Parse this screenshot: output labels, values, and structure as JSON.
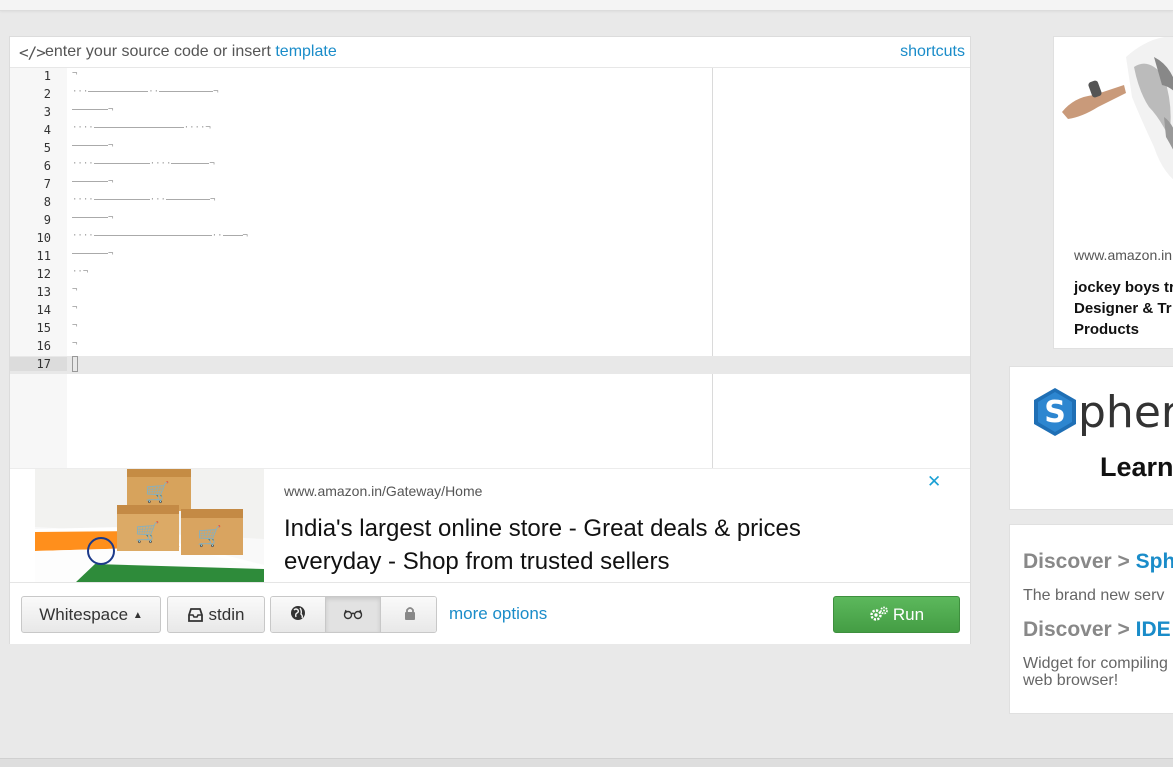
{
  "editor": {
    "header_prompt": "enter your source code or insert",
    "template_link": "template",
    "shortcuts_link": "shortcuts",
    "code_icon": "</>",
    "line_numbers": [
      "1",
      "2",
      "3",
      "4",
      "5",
      "6",
      "7",
      "8",
      "9",
      "10",
      "11",
      "12",
      "13",
      "14",
      "15",
      "16",
      "17"
    ],
    "active_line": "17"
  },
  "ad_banner": {
    "url": "www.amazon.in/Gateway/Home",
    "headline": "India's largest online store - Great deals & prices everyday - Shop from trusted sellers",
    "close_icon": "close-icon",
    "close_glyph": "✕"
  },
  "toolbar": {
    "language_label": "Whitespace",
    "stdin_label": "stdin",
    "more_options": "more options",
    "run_label": "Run",
    "icons": [
      "globe-icon",
      "glasses-icon",
      "lock-icon",
      "gears-icon",
      "inbox-icon",
      "caret-up-icon"
    ]
  },
  "side_ad": {
    "url": "www.amazon.in",
    "title": "jockey boys tr Designer & Tr Products"
  },
  "sphere": {
    "logo_letter": "S",
    "word": "phere",
    "learn": "Learn"
  },
  "discover": {
    "item1_prefix": "Discover > ",
    "item1_accent": "Sph",
    "item1_text": "The brand new serv",
    "item2_prefix": "Discover > ",
    "item2_accent": "IDE",
    "item2_text_1": "Widget for compiling",
    "item2_text_2": "web browser!"
  },
  "colors": {
    "link": "#1a8cc9",
    "run_green": "#5cb85c",
    "background": "#e9e9e9"
  }
}
